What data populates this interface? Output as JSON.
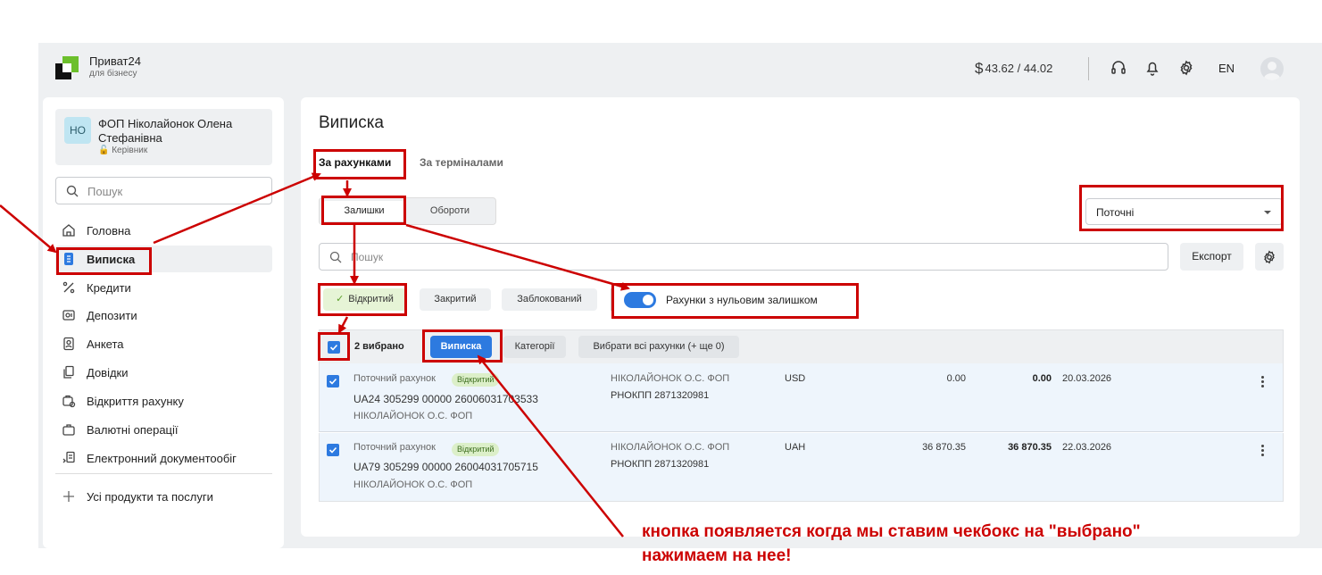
{
  "app": {
    "name": "Приват24",
    "subtitle": "для бізнесу",
    "rate": "43.62 / 44.02",
    "rate_symbol": "$",
    "lang": "EN"
  },
  "profile": {
    "initials": "НО",
    "name": "ФОП Ніколайонок Олена Стефанівна",
    "role": "Керівник"
  },
  "sidebar": {
    "search_placeholder": "Пошук",
    "items": [
      {
        "label": "Головна",
        "icon": "home-icon"
      },
      {
        "label": "Виписка",
        "icon": "statement-icon",
        "active": true
      },
      {
        "label": "Кредити",
        "icon": "percent-icon"
      },
      {
        "label": "Депозити",
        "icon": "deposit-icon"
      },
      {
        "label": "Анкета",
        "icon": "profile-card-icon"
      },
      {
        "label": "Довідки",
        "icon": "documents-icon"
      },
      {
        "label": "Відкриття рахунку",
        "icon": "open-account-icon"
      },
      {
        "label": "Валютні операції",
        "icon": "briefcase-icon"
      },
      {
        "label": "Електронний документообіг",
        "icon": "edoc-icon"
      }
    ],
    "all_products": "Усі продукти та послуги"
  },
  "main": {
    "title": "Виписка",
    "tabs": [
      "За рахунками",
      "За терміналами"
    ],
    "segments": [
      "Залишки",
      "Обороти"
    ],
    "select_value": "Поточні",
    "search_placeholder": "Пошук",
    "export_label": "Експорт",
    "filters": [
      "Відкритий",
      "Закритий",
      "Заблокований"
    ],
    "zero_balance_label": "Рахунки з нульовим залишком",
    "zero_balance_on": true
  },
  "table": {
    "selected_label": "2 вибрано",
    "vyp_button": "Виписка",
    "categories_button": "Категорії",
    "select_all_button": "Вибрати всі рахунки (+ ще 0)",
    "rows": [
      {
        "type": "Поточний рахунок",
        "status": "Відкритий",
        "iban": "UA24 305299 00000 26006031703533",
        "owner": "НІКОЛАЙОНОК О.С. ФОП",
        "holder": "НІКОЛАЙОНОК О.С. ФОП",
        "tax": "РНОКПП 2871320981",
        "currency": "USD",
        "balance": "0.00",
        "balance_bold": "0.00",
        "date": "20.03.2026"
      },
      {
        "type": "Поточний рахунок",
        "status": "Відкритий",
        "iban": "UA79 305299 00000 26004031705715",
        "owner": "НІКОЛАЙОНОК О.С. ФОП",
        "holder": "НІКОЛАЙОНОК О.С. ФОП",
        "tax": "РНОКПП 2871320981",
        "currency": "UAH",
        "balance": "36 870.35",
        "balance_bold": "36 870.35",
        "date": "22.03.2026"
      }
    ]
  },
  "annotation": {
    "line1": "кнопка появляется когда мы ставим чекбокс на \"выбрано\"",
    "line2": "нажимаем на нее!",
    "color": "#cc0000"
  }
}
